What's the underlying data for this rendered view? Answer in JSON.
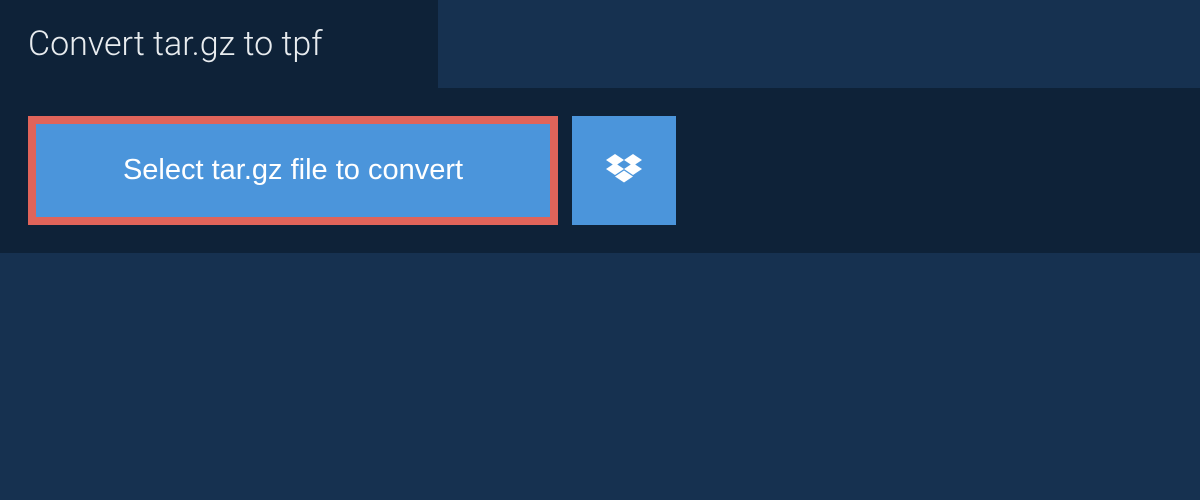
{
  "header": {
    "title": "Convert tar.gz to tpf"
  },
  "upload": {
    "select_button_label": "Select tar.gz file to convert"
  }
}
